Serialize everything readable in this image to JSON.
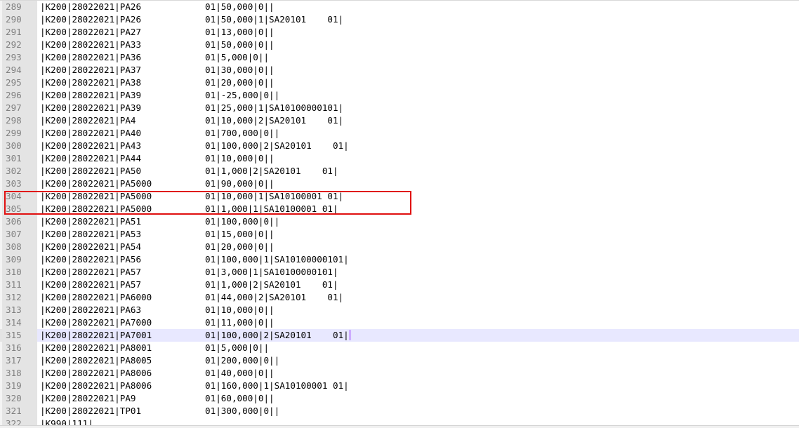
{
  "editor": {
    "current_line": "315",
    "lines": [
      {
        "num": "289",
        "text": "|K200|28022021|PA26            01|50,000|0||"
      },
      {
        "num": "290",
        "text": "|K200|28022021|PA26            01|50,000|1|SA20101    01|"
      },
      {
        "num": "291",
        "text": "|K200|28022021|PA27            01|13,000|0||"
      },
      {
        "num": "292",
        "text": "|K200|28022021|PA33            01|50,000|0||"
      },
      {
        "num": "293",
        "text": "|K200|28022021|PA36            01|5,000|0||"
      },
      {
        "num": "294",
        "text": "|K200|28022021|PA37            01|30,000|0||"
      },
      {
        "num": "295",
        "text": "|K200|28022021|PA38            01|20,000|0||"
      },
      {
        "num": "296",
        "text": "|K200|28022021|PA39            01|-25,000|0||"
      },
      {
        "num": "297",
        "text": "|K200|28022021|PA39            01|25,000|1|SA10100000101|"
      },
      {
        "num": "298",
        "text": "|K200|28022021|PA4             01|10,000|2|SA20101    01|"
      },
      {
        "num": "299",
        "text": "|K200|28022021|PA40            01|700,000|0||"
      },
      {
        "num": "300",
        "text": "|K200|28022021|PA43            01|100,000|2|SA20101    01|"
      },
      {
        "num": "301",
        "text": "|K200|28022021|PA44            01|10,000|0||"
      },
      {
        "num": "302",
        "text": "|K200|28022021|PA50            01|1,000|2|SA20101    01|"
      },
      {
        "num": "303",
        "text": "|K200|28022021|PA5000          01|90,000|0||"
      },
      {
        "num": "304",
        "text": "|K200|28022021|PA5000          01|10,000|1|SA10100001 01|"
      },
      {
        "num": "305",
        "text": "|K200|28022021|PA5000          01|1,000|1|SA10100001 01|"
      },
      {
        "num": "306",
        "text": "|K200|28022021|PA51            01|100,000|0||"
      },
      {
        "num": "307",
        "text": "|K200|28022021|PA53            01|15,000|0||"
      },
      {
        "num": "308",
        "text": "|K200|28022021|PA54            01|20,000|0||"
      },
      {
        "num": "309",
        "text": "|K200|28022021|PA56            01|100,000|1|SA10100000101|"
      },
      {
        "num": "310",
        "text": "|K200|28022021|PA57            01|3,000|1|SA10100000101|"
      },
      {
        "num": "311",
        "text": "|K200|28022021|PA57            01|1,000|2|SA20101    01|"
      },
      {
        "num": "312",
        "text": "|K200|28022021|PA6000          01|44,000|2|SA20101    01|"
      },
      {
        "num": "313",
        "text": "|K200|28022021|PA63            01|10,000|0||"
      },
      {
        "num": "314",
        "text": "|K200|28022021|PA7000          01|11,000|0||"
      },
      {
        "num": "315",
        "text": "|K200|28022021|PA7001          01|100,000|2|SA20101    01|"
      },
      {
        "num": "316",
        "text": "|K200|28022021|PA8001          01|5,000|0||"
      },
      {
        "num": "317",
        "text": "|K200|28022021|PA8005          01|200,000|0||"
      },
      {
        "num": "318",
        "text": "|K200|28022021|PA8006          01|40,000|0||"
      },
      {
        "num": "319",
        "text": "|K200|28022021|PA8006          01|160,000|1|SA10100001 01|"
      },
      {
        "num": "320",
        "text": "|K200|28022021|PA9             01|60,000|0||"
      },
      {
        "num": "321",
        "text": "|K200|28022021|TP01            01|300,000|0||"
      },
      {
        "num": "322",
        "text": "|K990|111|"
      }
    ]
  },
  "colors": {
    "highlight_box": "#e01010",
    "current_line_bg": "#e8e8ff",
    "gutter_bg": "#e4e4e4",
    "line_number_text": "#808080",
    "caret": "#8000ff"
  }
}
